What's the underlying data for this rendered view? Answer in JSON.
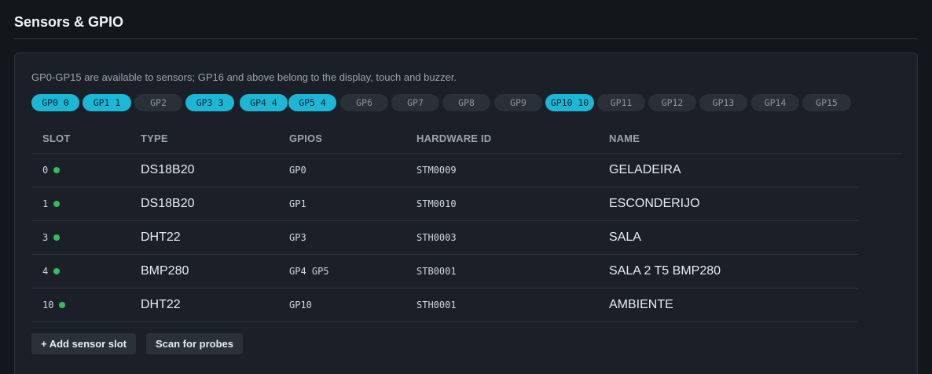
{
  "section": {
    "title": "Sensors & GPIO"
  },
  "card": {
    "note": "GP0-GP15 are available to sensors; GP16 and above belong to the display, touch and buzzer."
  },
  "colors": {
    "chip_used": "#1cb7d6",
    "chip_free": "#2a3038",
    "status_ok": "#2fbf5e"
  },
  "gpio_chips": [
    {
      "label": "GP0 0",
      "used": true
    },
    {
      "label": "GP1 1",
      "used": true
    },
    {
      "label": "GP2",
      "used": false
    },
    {
      "label": "GP3 3",
      "used": true
    },
    {
      "label": "GP4 4",
      "used": true
    },
    {
      "label": "GP5 4",
      "used": true
    },
    {
      "label": "GP6",
      "used": false
    },
    {
      "label": "GP7",
      "used": false
    },
    {
      "label": "GP8",
      "used": false
    },
    {
      "label": "GP9",
      "used": false
    },
    {
      "label": "GP10 10",
      "used": true
    },
    {
      "label": "GP11",
      "used": false
    },
    {
      "label": "GP12",
      "used": false
    },
    {
      "label": "GP13",
      "used": false
    },
    {
      "label": "GP14",
      "used": false
    },
    {
      "label": "GP15",
      "used": false
    }
  ],
  "table": {
    "headers": {
      "slot": "SLOT",
      "type": "TYPE",
      "gpios": "GPIOS",
      "hardware_id": "HARDWARE ID",
      "name": "NAME"
    },
    "rows": [
      {
        "slot": "0",
        "status": "ok",
        "type": "DS18B20",
        "gpios": "GP0",
        "hardware_id": "STM0009",
        "name": "GELADEIRA"
      },
      {
        "slot": "1",
        "status": "ok",
        "type": "DS18B20",
        "gpios": "GP1",
        "hardware_id": "STM0010",
        "name": "ESCONDERIJO"
      },
      {
        "slot": "3",
        "status": "ok",
        "type": "DHT22",
        "gpios": "GP3",
        "hardware_id": "STH0003",
        "name": "SALA"
      },
      {
        "slot": "4",
        "status": "ok",
        "type": "BMP280",
        "gpios": "GP4 GP5",
        "hardware_id": "STB0001",
        "name": "SALA 2 T5 BMP280"
      },
      {
        "slot": "10",
        "status": "ok",
        "type": "DHT22",
        "gpios": "GP10",
        "hardware_id": "STH0001",
        "name": "AMBIENTE"
      }
    ]
  },
  "actions": {
    "add_slot": "+ Add sensor slot",
    "scan": "Scan for probes"
  }
}
